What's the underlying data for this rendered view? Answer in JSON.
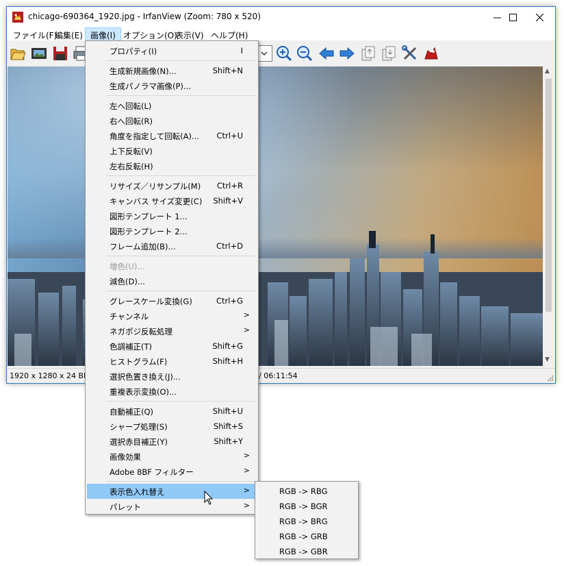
{
  "window": {
    "title": "chicago-690364_1920.jpg - IrfanView (Zoom: 780 x 520)"
  },
  "menubar": {
    "items": [
      {
        "label": "ファイル(F)"
      },
      {
        "label": "編集(E)"
      },
      {
        "label": "画像(I)"
      },
      {
        "label": "オプション(O)"
      },
      {
        "label": "表示(V)"
      },
      {
        "label": "ヘルプ(H)"
      }
    ]
  },
  "toolbar": {
    "icons": [
      "open-icon",
      "slideshow-icon",
      "save-icon",
      "print-icon",
      "zoom-in-icon",
      "zoom-out-icon",
      "previous-icon",
      "next-icon",
      "copy-icon",
      "paste-icon",
      "properties-icon",
      "irfan-icon"
    ]
  },
  "statusbar": {
    "info": "1920 x 1280 x 24 BPP",
    "time": "/ 06:11:54"
  },
  "image_menu": {
    "items": [
      {
        "label": "プロパティ(I)",
        "shortcut": "I"
      },
      {
        "label": "生成新規画像(N)...",
        "shortcut": "Shift+N"
      },
      {
        "label": "生成パノラマ画像(P)...",
        "shortcut": ""
      },
      {
        "label": "左へ回転(L)",
        "shortcut": ""
      },
      {
        "label": "右へ回転(R)",
        "shortcut": ""
      },
      {
        "label": "角度を指定して回転(A)...",
        "shortcut": "Ctrl+U"
      },
      {
        "label": "上下反転(V)",
        "shortcut": ""
      },
      {
        "label": "左右反転(H)",
        "shortcut": ""
      },
      {
        "label": "リサイズ／リサンプル(M)",
        "shortcut": "Ctrl+R"
      },
      {
        "label": "キャンバス サイズ変更(C)",
        "shortcut": "Shift+V"
      },
      {
        "label": "図形テンプレート 1...",
        "shortcut": ""
      },
      {
        "label": "図形テンプレート 2...",
        "shortcut": ""
      },
      {
        "label": "フレーム追加(B)...",
        "shortcut": "Ctrl+D"
      },
      {
        "label": "増色(U)...",
        "shortcut": ""
      },
      {
        "label": "減色(D)...",
        "shortcut": ""
      },
      {
        "label": "グレースケール変換(G)",
        "shortcut": "Ctrl+G"
      },
      {
        "label": "チャンネル",
        "shortcut": ""
      },
      {
        "label": "ネガポジ反転処理",
        "shortcut": ""
      },
      {
        "label": "色調補正(T)",
        "shortcut": "Shift+G"
      },
      {
        "label": "ヒストグラム(F)",
        "shortcut": "Shift+H"
      },
      {
        "label": "選択色置き換え(J)...",
        "shortcut": ""
      },
      {
        "label": "重複表示変換(O)...",
        "shortcut": ""
      },
      {
        "label": "自動補正(Q)",
        "shortcut": "Shift+U"
      },
      {
        "label": "シャープ処理(S)",
        "shortcut": "Shift+S"
      },
      {
        "label": "選択赤目補正(Y)",
        "shortcut": "Shift+Y"
      },
      {
        "label": "画像効果",
        "shortcut": ""
      },
      {
        "label": "Adobe 8BF フィルター",
        "shortcut": ""
      },
      {
        "label": "表示色入れ替え",
        "shortcut": ""
      },
      {
        "label": "パレット",
        "shortcut": ""
      }
    ],
    "submenu_arrow": ">"
  },
  "swap_submenu": {
    "items": [
      {
        "label": "RGB -> RBG"
      },
      {
        "label": "RGB -> BGR"
      },
      {
        "label": "RGB -> BRG"
      },
      {
        "label": "RGB -> GRB"
      },
      {
        "label": "RGB -> GBR"
      }
    ]
  },
  "colors": {
    "menu_highlight": "#91c9f7",
    "menubar_active": "#cce8ff",
    "window_border": "#2b79c2"
  }
}
